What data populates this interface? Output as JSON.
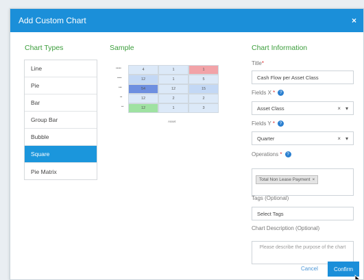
{
  "modal": {
    "title": "Add Custom Chart",
    "close_label": "×"
  },
  "chart_types": {
    "heading": "Chart Types",
    "items": [
      "Line",
      "Pie",
      "Bar",
      "Group Bar",
      "Bubble",
      "Square",
      "Pie Matrix"
    ],
    "selected": "Square"
  },
  "sample": {
    "heading": "Sample",
    "grid": [
      [
        "4",
        "1",
        "1"
      ],
      [
        "12",
        "1",
        "5"
      ],
      [
        "54",
        "12",
        "15"
      ],
      [
        "12",
        "2",
        "2"
      ],
      [
        "12",
        "1",
        "3"
      ]
    ],
    "colors": {
      "red": "#f2a3a8",
      "light_blue": "#c3d8f5",
      "dark_blue": "#6e8fe0",
      "pale_blue": "#dce9f8",
      "green": "#9fe2a2"
    },
    "x_label": "Asset"
  },
  "chart_info": {
    "heading": "Chart Information",
    "title_label": "Title",
    "title_required": "*",
    "title_value": "Cash Flow per Asset Class",
    "fields_x_label": "Fields X",
    "fields_x_required": "*",
    "fields_x_value": "Asset Class",
    "fields_y_label": "Fields Y",
    "fields_y_required": "*",
    "fields_y_value": "Quarter",
    "operations_label": "Operations",
    "operations_required": "*",
    "operations_chip": "Total Non Lease Payment",
    "tags_label": "Tags (Optional)",
    "tags_placeholder": "Select Tags",
    "description_label": "Chart Description (Optional)",
    "description_placeholder": "Please describe the purpose of the chart",
    "clear_icon": "×",
    "dropdown_icon": "▾",
    "help_icon": "?"
  },
  "footer": {
    "cancel_label": "Cancel",
    "confirm_label": "Confirm"
  }
}
